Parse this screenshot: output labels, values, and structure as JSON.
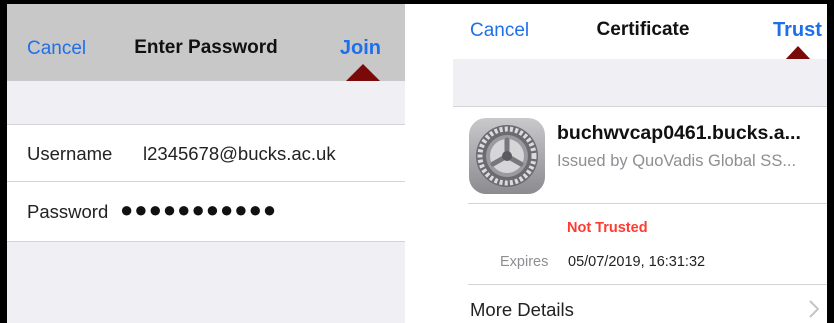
{
  "left_panel": {
    "nav": {
      "cancel_label": "Cancel",
      "title": "Enter Password",
      "join_label": "Join"
    },
    "fields": {
      "username_label": "Username",
      "username_value": "l2345678@bucks.ac.uk",
      "password_label": "Password",
      "password_value": "●●●●●●●●●●●"
    }
  },
  "right_panel": {
    "nav": {
      "cancel_label": "Cancel",
      "title": "Certificate",
      "trust_label": "Trust"
    },
    "certificate": {
      "name": "buchwvcap0461.bucks.a...",
      "issued_by": "Issued by QuoVadis Global SS...",
      "status": "Not Trusted",
      "expires_label": "Expires",
      "expires_value": "05/07/2019, 16:31:32"
    },
    "more_details_label": "More Details"
  },
  "colors": {
    "accent": "#1f6feb",
    "annotation_arrow": "#7a0a0a",
    "warning": "#ff3b30",
    "grouped_bg": "#efeff4"
  },
  "icons": [
    "up-arrow-annotation-icon",
    "settings-gear-icon",
    "chevron-right-icon"
  ]
}
